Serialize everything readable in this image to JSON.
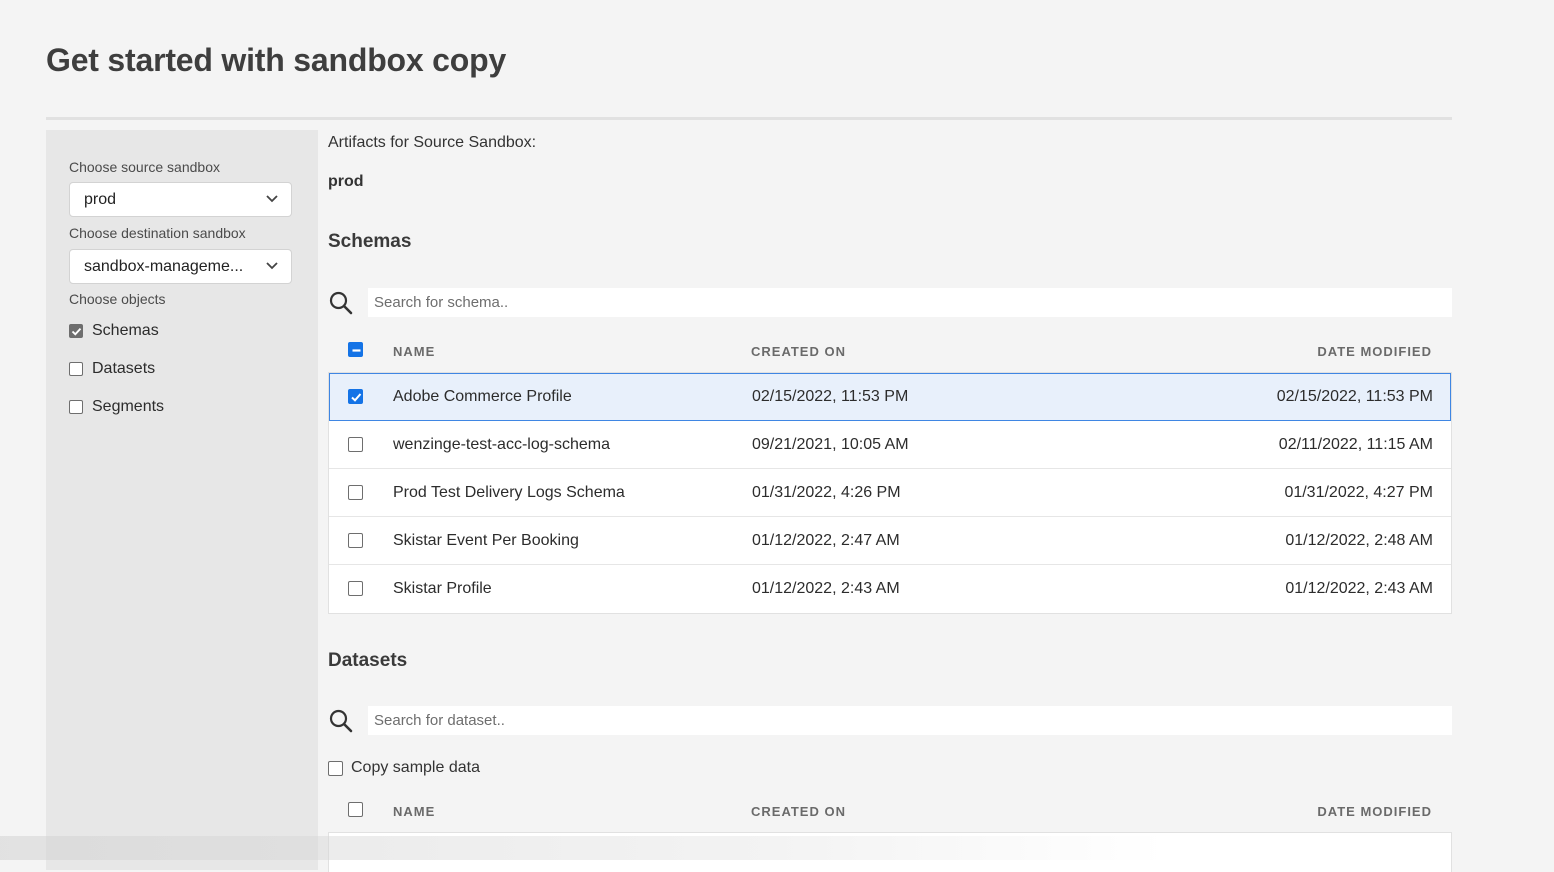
{
  "page": {
    "title": "Get started with sandbox copy"
  },
  "sidebar": {
    "source_label": "Choose source sandbox",
    "source_value": "prod",
    "destination_label": "Choose destination sandbox",
    "destination_value": "sandbox-manageme...",
    "objects_label": "Choose objects",
    "objects": [
      {
        "label": "Schemas",
        "checked": true
      },
      {
        "label": "Datasets",
        "checked": false
      },
      {
        "label": "Segments",
        "checked": false
      }
    ]
  },
  "main": {
    "subheading": "Artifacts for Source Sandbox:",
    "source_name": "prod",
    "schemas": {
      "title": "Schemas",
      "search_placeholder": "Search for schema..",
      "header_state": "indeterminate",
      "columns": [
        "NAME",
        "CREATED ON",
        "DATE MODIFIED"
      ],
      "rows": [
        {
          "name": "Adobe Commerce Profile",
          "created": "02/15/2022, 11:53 PM",
          "modified": "02/15/2022, 11:53 PM",
          "selected": true
        },
        {
          "name": "wenzinge-test-acc-log-schema",
          "created": "09/21/2021, 10:05 AM",
          "modified": "02/11/2022, 11:15 AM",
          "selected": false
        },
        {
          "name": "Prod Test Delivery Logs Schema",
          "created": "01/31/2022, 4:26 PM",
          "modified": "01/31/2022, 4:27 PM",
          "selected": false
        },
        {
          "name": "Skistar Event Per Booking",
          "created": "01/12/2022, 2:47 AM",
          "modified": "01/12/2022, 2:48 AM",
          "selected": false
        },
        {
          "name": "Skistar Profile",
          "created": "01/12/2022, 2:43 AM",
          "modified": "01/12/2022, 2:43 AM",
          "selected": false
        }
      ]
    },
    "datasets": {
      "title": "Datasets",
      "search_placeholder": "Search for dataset..",
      "copy_sample_label": "Copy sample data",
      "copy_sample_checked": false,
      "columns": [
        "NAME",
        "CREATED ON",
        "DATE MODIFIED"
      ]
    }
  },
  "colors": {
    "accent": "#1473e6",
    "selected_row_bg": "#e8f0fb",
    "sidebar_bg": "#e7e7e7"
  },
  "icons": {
    "search": "search-icon",
    "chevron": "chevron-down-icon",
    "check": "check-icon"
  }
}
